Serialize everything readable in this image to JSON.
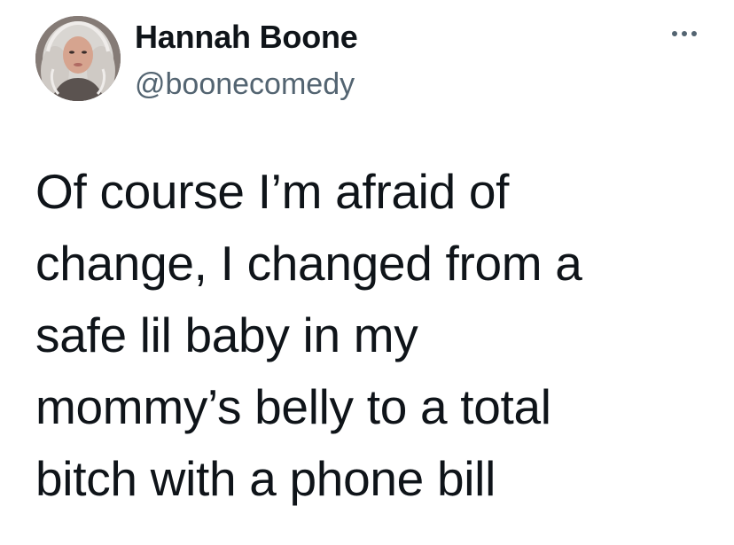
{
  "author": {
    "name": "Hannah Boone",
    "handle": "@boonecomedy",
    "avatar_icon": "user-avatar"
  },
  "menu": {
    "icon": "more-horizontal-icon"
  },
  "tweet": {
    "lines": [
      "Of course I’m afraid of",
      "change, I changed from a",
      "safe lil baby in my",
      "mommy’s belly to a total",
      "bitch with a phone bill"
    ]
  }
}
